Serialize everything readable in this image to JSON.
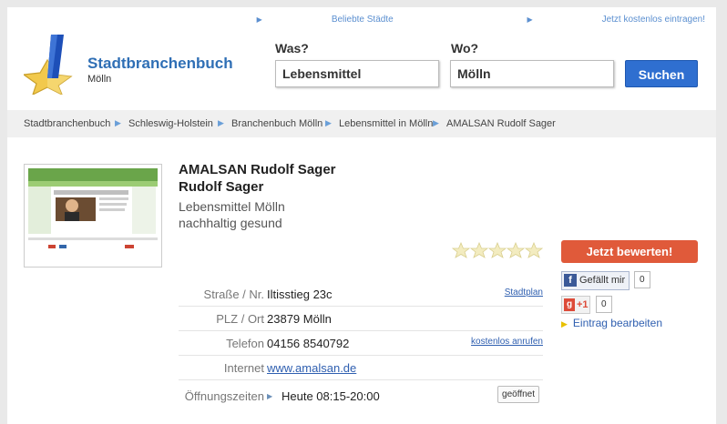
{
  "header": {
    "top_links": [
      "Beliebte Städte",
      "Jetzt kostenlos eintragen!"
    ],
    "brand": "Stadtbranchenbuch",
    "city": "Mölln",
    "search": {
      "what_label": "Was?",
      "what_value": "Lebensmittel",
      "where_label": "Wo?",
      "where_value": "Mölln",
      "button": "Suchen"
    }
  },
  "breadcrumb": [
    "Stadtbranchenbuch",
    "Schleswig-Holstein",
    "Branchenbuch Mölln",
    "Lebensmittel in Mölln",
    "AMALSAN Rudolf Sager"
  ],
  "listing": {
    "name": "AMALSAN Rudolf Sager",
    "owner": "Rudolf Sager",
    "category": "Lebensmittel Mölln",
    "slogan": "nachhaltig gesund",
    "rating_stars": 0,
    "rows": {
      "street_label": "Straße / Nr.",
      "street_value": "Iltisstieg 23c",
      "street_action": "Stadtplan",
      "city_label": "PLZ / Ort",
      "city_value": "23879 Mölln",
      "phone_label": "Telefon",
      "phone_value": "04156 8540792",
      "phone_action": "kostenlos anrufen",
      "web_label": "Internet",
      "web_value": "www.amalsan.de",
      "hours_label": "Öffnungszeiten",
      "hours_value": "Heute 08:15-20:00",
      "hours_status": "geöffnet"
    }
  },
  "sidebar": {
    "rate_button": "Jetzt bewerten!",
    "fb_label": "Gefällt mir",
    "fb_count": "0",
    "gplus_label": "+1",
    "gplus_count": "0",
    "edit_link": "Eintrag bearbeiten"
  },
  "colors": {
    "brand": "#2f6fb5",
    "search_button": "#2f6fd0",
    "rate_button": "#e05a3a",
    "facebook": "#3b5998",
    "gplus": "#dd4b39"
  }
}
